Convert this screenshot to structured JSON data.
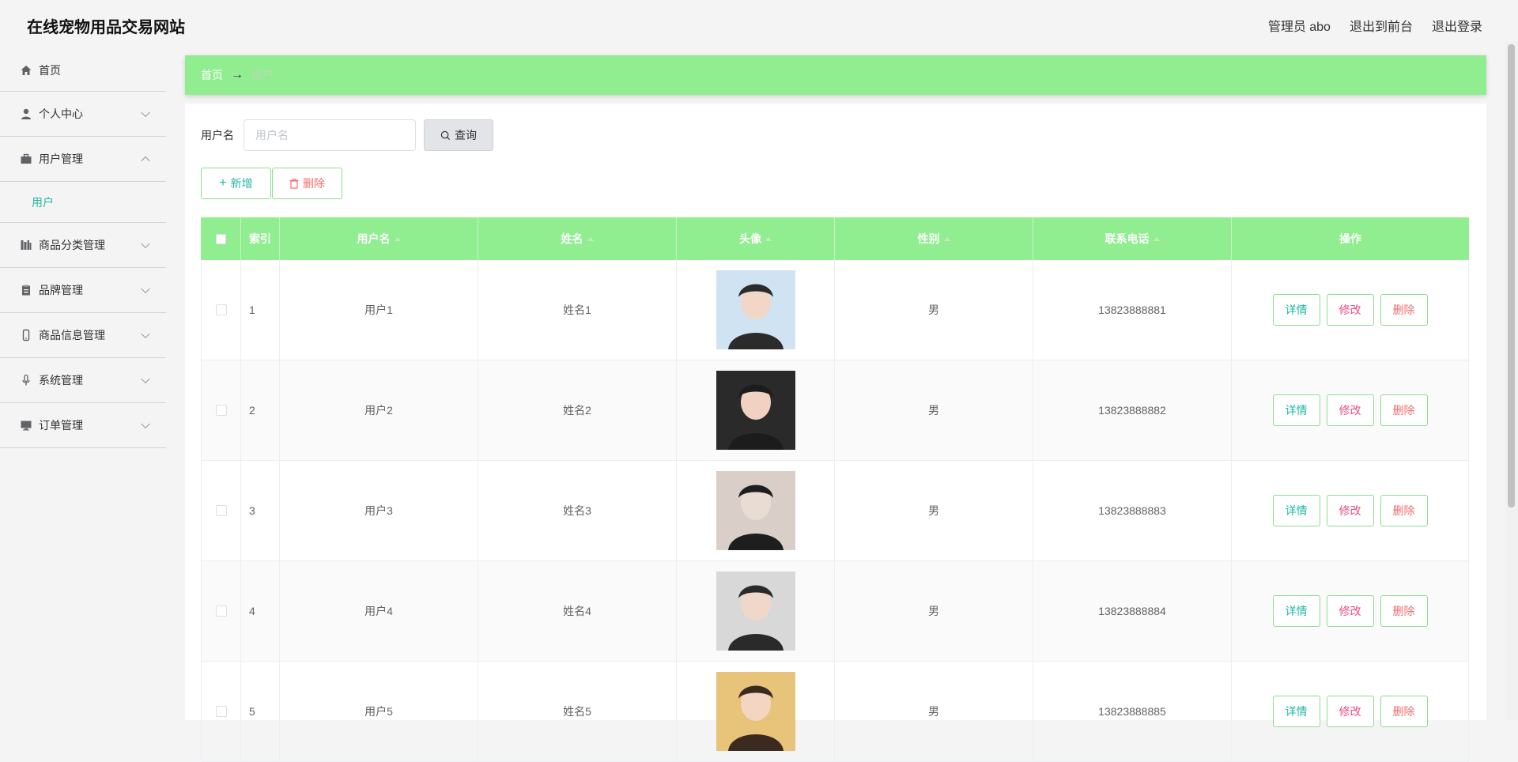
{
  "header": {
    "title": "在线宠物用品交易网站",
    "admin_label": "管理员 abo",
    "to_front_label": "退出到前台",
    "logout_label": "退出登录"
  },
  "sidebar": {
    "items": [
      {
        "label": "首页",
        "icon": "home-icon"
      },
      {
        "label": "个人中心",
        "icon": "user-icon"
      },
      {
        "label": "用户管理",
        "icon": "briefcase-icon"
      },
      {
        "label": "商品分类管理",
        "icon": "library-icon"
      },
      {
        "label": "品牌管理",
        "icon": "clipboard-icon"
      },
      {
        "label": "商品信息管理",
        "icon": "mobile-icon"
      },
      {
        "label": "系统管理",
        "icon": "microphone-icon"
      },
      {
        "label": "订单管理",
        "icon": "monitor-icon"
      }
    ],
    "sub_item": "用户"
  },
  "breadcrumb": {
    "home": "首页",
    "separator": "→",
    "current": "用户"
  },
  "search": {
    "label": "用户名",
    "placeholder": "用户名",
    "button": "查询"
  },
  "actions": {
    "add": "新增",
    "delete": "删除"
  },
  "table": {
    "columns": [
      "",
      "索引",
      "用户名",
      "姓名",
      "头像",
      "性别",
      "联系电话",
      "操作"
    ],
    "rows": [
      {
        "index": "1",
        "username": "用户1",
        "name": "姓名1",
        "gender": "男",
        "phone": "13823888881"
      },
      {
        "index": "2",
        "username": "用户2",
        "name": "姓名2",
        "gender": "男",
        "phone": "13823888882"
      },
      {
        "index": "3",
        "username": "用户3",
        "name": "姓名3",
        "gender": "男",
        "phone": "13823888883"
      },
      {
        "index": "4",
        "username": "用户4",
        "name": "姓名4",
        "gender": "男",
        "phone": "13823888884"
      },
      {
        "index": "5",
        "username": "用户5",
        "name": "姓名5",
        "gender": "男",
        "phone": "13823888885"
      }
    ],
    "row_buttons": {
      "detail": "详情",
      "edit": "修改",
      "remove": "删除"
    }
  },
  "colors": {
    "accent_green": "#90ee90",
    "teal_text": "#20b7a4",
    "danger": "#f56c6c"
  }
}
